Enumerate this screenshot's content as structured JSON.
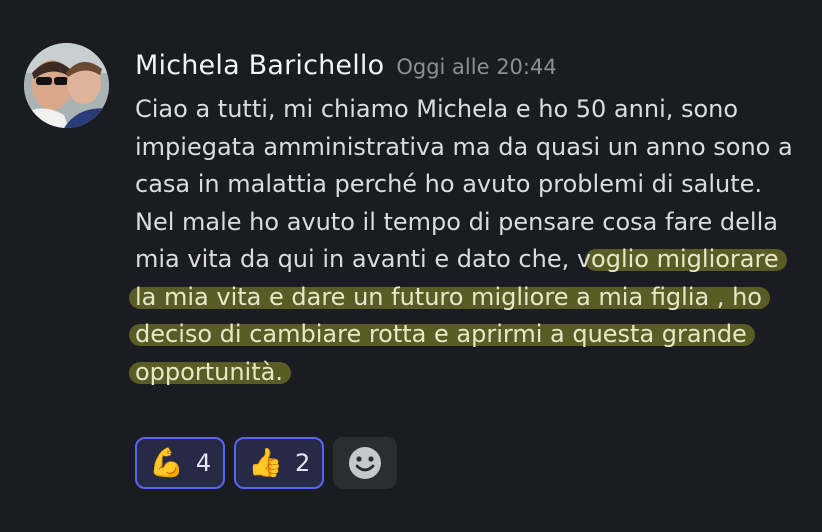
{
  "message": {
    "author": "Michela Barichello",
    "timestamp": "Oggi alle 20:44",
    "lines": [
      {
        "text": "Ciao a tutti, mi chiamo Michela e ho 50 anni, sono",
        "highlight": ""
      },
      {
        "text": "impiegata amministrativa ma da quasi un anno sono a",
        "highlight": ""
      },
      {
        "text": "casa in malattia perché ho avuto problemi di salute.",
        "highlight": ""
      },
      {
        "text": "Nel male ho avuto il tempo di pensare cosa fare della",
        "highlight": ""
      },
      {
        "text": "mia vita da qui in avanti e dato che, v",
        "highlight": "oglio migliorare"
      },
      {
        "text": "",
        "highlight": "la mia vita e dare un futuro migliore a mia figlia , ho"
      },
      {
        "text": "",
        "highlight": "deciso di cambiare rotta e aprirmi a questa grande"
      },
      {
        "text": "",
        "highlight": "opportunità."
      }
    ],
    "highlight_color": "#8c9128"
  },
  "reactions": [
    {
      "emoji": "💪",
      "icon": "flexed-biceps-icon",
      "count": "4"
    },
    {
      "emoji": "👍",
      "icon": "thumbs-up-icon",
      "count": "2"
    }
  ],
  "add_reaction_icon": "smiley-face-icon",
  "colors": {
    "background": "#1b1c21",
    "reaction_border": "#5865f2",
    "reaction_bg": "#262a45"
  }
}
